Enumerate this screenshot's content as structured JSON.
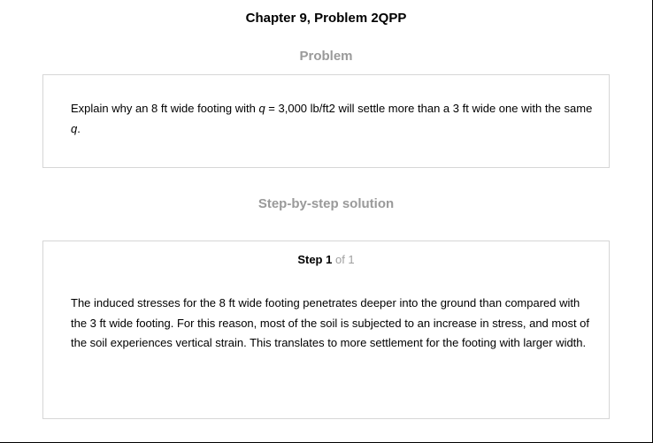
{
  "chapter_title": "Chapter 9, Problem 2QPP",
  "problem": {
    "heading": "Problem",
    "text_part1": "Explain why an 8 ft wide footing with ",
    "text_var1": "q",
    "text_part2": " = 3,000 lb/ft2 will settle more than a 3 ft wide one with the same ",
    "text_var2": "q",
    "text_part3": "."
  },
  "solution": {
    "heading": "Step-by-step solution",
    "step_label": "Step 1",
    "step_of": "of 1",
    "text": "The induced stresses for the 8 ft wide footing penetrates deeper into the ground than compared with the 3 ft wide footing. For this reason, most of the soil is subjected to an increase in stress, and most of the soil experiences vertical strain. This translates to more settlement for the footing with larger width."
  }
}
